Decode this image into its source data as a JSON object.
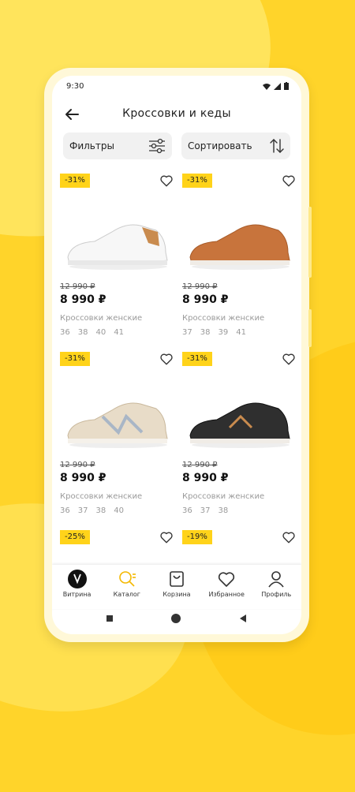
{
  "status_bar": {
    "time": "9:30"
  },
  "header": {
    "title": "Кроссовки и кеды",
    "back_icon": "arrow-left-icon"
  },
  "filters": {
    "filter_label": "Фильтры",
    "sort_label": "Сортировать"
  },
  "products": [
    {
      "discount": "-31%",
      "old_price": "12 990 ₽",
      "price": "8 990 ₽",
      "name": "Кроссовки женские",
      "sizes": [
        "36",
        "38",
        "40",
        "41"
      ]
    },
    {
      "discount": "-31%",
      "old_price": "12 990 ₽",
      "price": "8 990 ₽",
      "name": "Кроссовки женские",
      "sizes": [
        "37",
        "38",
        "39",
        "41"
      ]
    },
    {
      "discount": "-31%",
      "old_price": "12 990 ₽",
      "price": "8 990 ₽",
      "name": "Кроссовки женские",
      "sizes": [
        "36",
        "37",
        "38",
        "40"
      ]
    },
    {
      "discount": "-31%",
      "old_price": "12 990 ₽",
      "price": "8 990 ₽",
      "name": "Кроссовки женские",
      "sizes": [
        "36",
        "37",
        "38"
      ]
    },
    {
      "discount": "-25%"
    },
    {
      "discount": "-19%"
    }
  ],
  "nav": [
    {
      "label": "Витрина",
      "icon": "store-logo-icon"
    },
    {
      "label": "Каталог",
      "icon": "catalog-search-icon"
    },
    {
      "label": "Корзина",
      "icon": "bag-icon"
    },
    {
      "label": "Избранное",
      "icon": "heart-icon"
    },
    {
      "label": "Профиль",
      "icon": "user-icon"
    }
  ],
  "colors": {
    "accent": "#ffd31a",
    "background": "#ffd42a",
    "active_nav": "#f4b800"
  }
}
